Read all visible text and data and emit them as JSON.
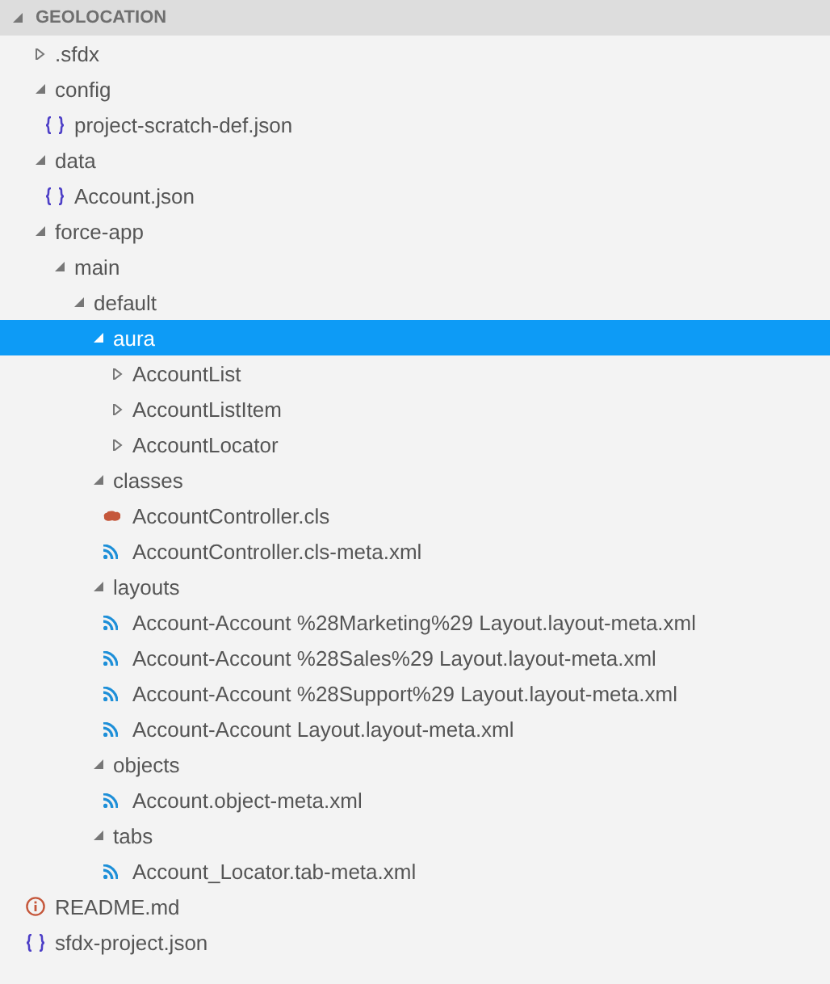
{
  "explorer": {
    "title": "GEOLOCATION",
    "expanded": true,
    "items": [
      {
        "kind": "folder",
        "label": ".sfdx",
        "expanded": false,
        "selected": false
      },
      {
        "kind": "folder",
        "label": "config",
        "expanded": true,
        "selected": false,
        "children": [
          {
            "kind": "json",
            "label": "project-scratch-def.json",
            "selected": false
          }
        ]
      },
      {
        "kind": "folder",
        "label": "data",
        "expanded": true,
        "selected": false,
        "children": [
          {
            "kind": "json",
            "label": "Account.json",
            "selected": false
          }
        ]
      },
      {
        "kind": "folder",
        "label": "force-app",
        "expanded": true,
        "selected": false,
        "children": [
          {
            "kind": "folder",
            "label": "main",
            "expanded": true,
            "selected": false,
            "children": [
              {
                "kind": "folder",
                "label": "default",
                "expanded": true,
                "selected": false,
                "children": [
                  {
                    "kind": "folder",
                    "label": "aura",
                    "expanded": true,
                    "selected": true,
                    "children": [
                      {
                        "kind": "folder",
                        "label": "AccountList",
                        "expanded": false,
                        "selected": false
                      },
                      {
                        "kind": "folder",
                        "label": "AccountListItem",
                        "expanded": false,
                        "selected": false
                      },
                      {
                        "kind": "folder",
                        "label": "AccountLocator",
                        "expanded": false,
                        "selected": false
                      }
                    ]
                  },
                  {
                    "kind": "folder",
                    "label": "classes",
                    "expanded": true,
                    "selected": false,
                    "children": [
                      {
                        "kind": "apex",
                        "label": "AccountController.cls",
                        "selected": false
                      },
                      {
                        "kind": "xml",
                        "label": "AccountController.cls-meta.xml",
                        "selected": false
                      }
                    ]
                  },
                  {
                    "kind": "folder",
                    "label": "layouts",
                    "expanded": true,
                    "selected": false,
                    "children": [
                      {
                        "kind": "xml",
                        "label": "Account-Account %28Marketing%29 Layout.layout-meta.xml",
                        "selected": false
                      },
                      {
                        "kind": "xml",
                        "label": "Account-Account %28Sales%29 Layout.layout-meta.xml",
                        "selected": false
                      },
                      {
                        "kind": "xml",
                        "label": "Account-Account %28Support%29 Layout.layout-meta.xml",
                        "selected": false
                      },
                      {
                        "kind": "xml",
                        "label": "Account-Account Layout.layout-meta.xml",
                        "selected": false
                      }
                    ]
                  },
                  {
                    "kind": "folder",
                    "label": "objects",
                    "expanded": true,
                    "selected": false,
                    "children": [
                      {
                        "kind": "xml",
                        "label": "Account.object-meta.xml",
                        "selected": false
                      }
                    ]
                  },
                  {
                    "kind": "folder",
                    "label": "tabs",
                    "expanded": true,
                    "selected": false,
                    "children": [
                      {
                        "kind": "xml",
                        "label": "Account_Locator.tab-meta.xml",
                        "selected": false
                      }
                    ]
                  }
                ]
              }
            ]
          }
        ]
      },
      {
        "kind": "info",
        "label": "README.md",
        "selected": false
      },
      {
        "kind": "json",
        "label": "sfdx-project.json",
        "selected": false
      }
    ]
  }
}
